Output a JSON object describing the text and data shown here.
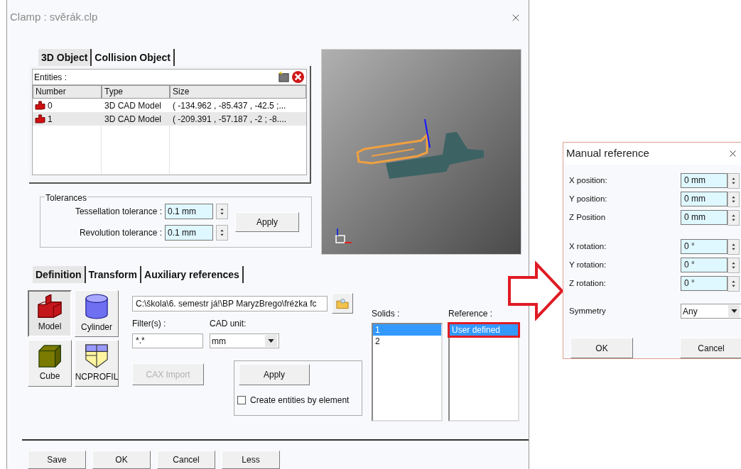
{
  "main_window": {
    "title": "Clamp : svěrák.clp"
  },
  "object_tabs": [
    {
      "label": "3D Object",
      "selected": true
    },
    {
      "label": "Collision Object",
      "selected": false
    }
  ],
  "entities": {
    "label": "Entities :",
    "columns": [
      "Number",
      "Type",
      "Size"
    ],
    "rows": [
      {
        "number": "0",
        "type": "3D CAD Model",
        "size": "( -134.962 , -85.437 , -42.5 ;...",
        "selected": false
      },
      {
        "number": "1",
        "type": "3D CAD Model",
        "size": "( -209.391 , -57.187 , -2 ; -8....",
        "selected": true
      }
    ]
  },
  "tolerances": {
    "title": "Tolerances",
    "fields": [
      {
        "label": "Tessellation tolerance :",
        "value": "0.1 mm"
      },
      {
        "label": "Revolution tolerance :",
        "value": "0.1 mm"
      }
    ],
    "apply": "Apply"
  },
  "definition_tabs": [
    {
      "label": "Definition",
      "selected": true
    },
    {
      "label": "Transform",
      "selected": false
    },
    {
      "label": "Auxiliary references",
      "selected": false
    }
  ],
  "shapes": [
    {
      "label": "Model",
      "kind": "model",
      "selected": true
    },
    {
      "label": "Cylinder",
      "kind": "cylinder",
      "selected": false
    },
    {
      "label": "Cube",
      "kind": "cube",
      "selected": false
    },
    {
      "label": "NCPROFIL",
      "kind": "profile",
      "selected": false
    }
  ],
  "file_path": "C:\\škola\\6. semestr já!\\BP MaryzBrego\\frézka fc",
  "filter": {
    "label": "Filter(s) :",
    "value": "*.*"
  },
  "cad_unit": {
    "label": "CAD unit:",
    "value": "mm"
  },
  "cax_import": {
    "label": "CAX Import",
    "disabled": true
  },
  "apply": "Apply",
  "create_entities": {
    "label": "Create entities by element",
    "checked": false
  },
  "solids": {
    "label": "Solids :",
    "items": [
      {
        "label": "1",
        "selected": true
      },
      {
        "label": "2",
        "selected": false
      }
    ]
  },
  "reference": {
    "label": "Reference :",
    "items": [
      {
        "label": "User defined",
        "selected": true
      }
    ]
  },
  "buttons": [
    "Save",
    "OK",
    "Cancel",
    "Less"
  ],
  "manual_reference": {
    "title": "Manual reference",
    "position_fields": [
      {
        "label": "X position:",
        "value": "0 mm"
      },
      {
        "label": "Y position:",
        "value": "0 mm"
      },
      {
        "label": "Z Position",
        "value": "0 mm"
      }
    ],
    "rotation_fields": [
      {
        "label": "X rotation:",
        "value": "0 °"
      },
      {
        "label": "Y rotation:",
        "value": "0 °"
      },
      {
        "label": "Z rotation:",
        "value": "0 °"
      }
    ],
    "symmetry": {
      "label": "Symmetry",
      "value": "Any"
    },
    "buttons": [
      "OK",
      "Cancel"
    ]
  }
}
